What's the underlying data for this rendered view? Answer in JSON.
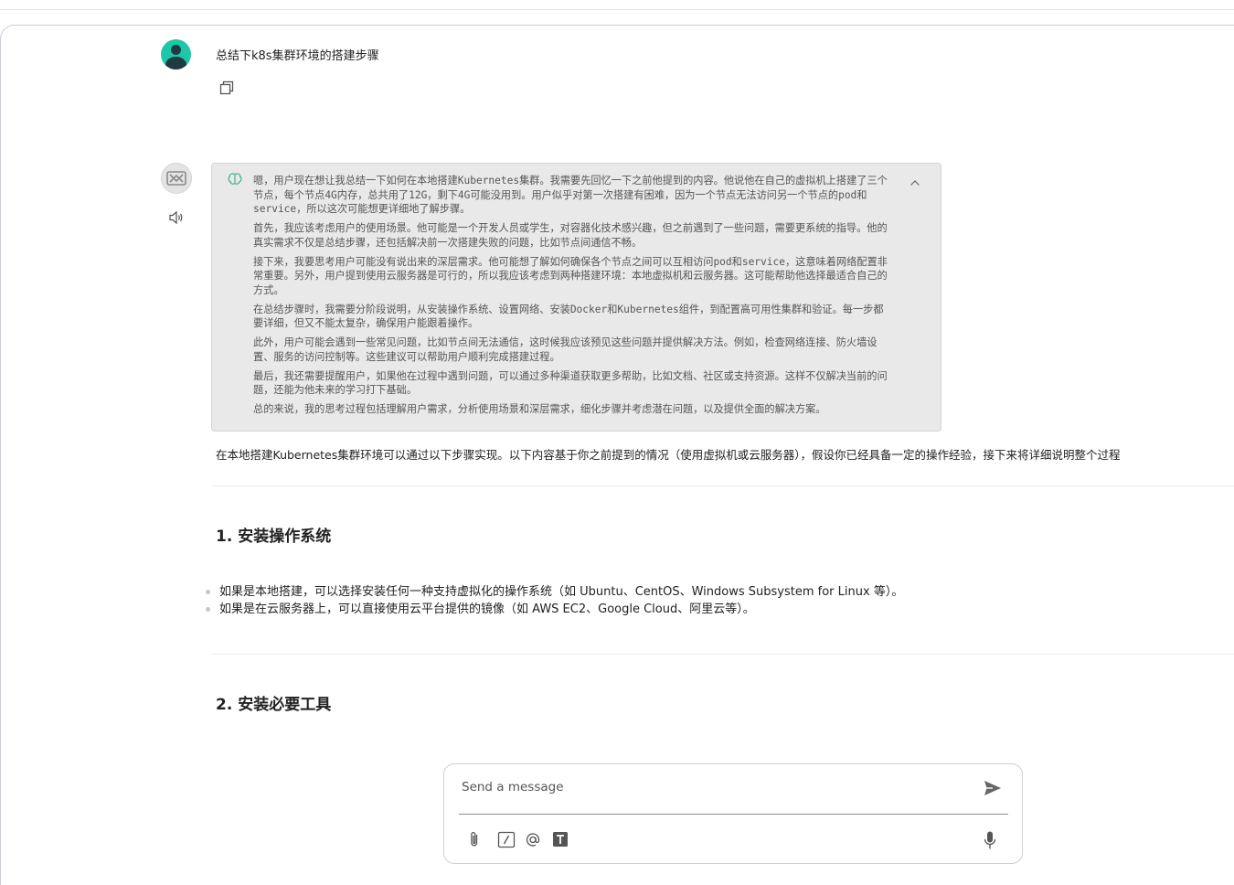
{
  "user_message": {
    "text": "总结下k8s集群环境的搭建步骤",
    "icons": [
      "user-avatar",
      "copy-icon"
    ]
  },
  "assistant": {
    "icons": [
      "bot-avatar",
      "speaker-icon",
      "brain-icon",
      "chevron-up-icon"
    ],
    "thinking": [
      "嗯，用户现在想让我总结一下如何在本地搭建Kubernetes集群。我需要先回忆一下之前他提到的内容。他说他在自己的虚拟机上搭建了三个节点，每个节点4G内存，总共用了12G，剩下4G可能没用到。用户似乎对第一次搭建有困难，因为一个节点无法访问另一个节点的pod和service，所以这次可能想更详细地了解步骤。",
      "首先，我应该考虑用户的使用场景。他可能是一个开发人员或学生，对容器化技术感兴趣，但之前遇到了一些问题，需要更系统的指导。他的真实需求不仅是总结步骤，还包括解决前一次搭建失败的问题，比如节点间通信不畅。",
      "接下来，我要思考用户可能没有说出来的深层需求。他可能想了解如何确保各个节点之间可以互相访问pod和service，这意味着网络配置非常重要。另外，用户提到使用云服务器是可行的，所以我应该考虑到两种搭建环境：本地虚拟机和云服务器。这可能帮助他选择最适合自己的方式。",
      "在总结步骤时，我需要分阶段说明，从安装操作系统、设置网络、安装Docker和Kubernetes组件，到配置高可用性集群和验证。每一步都要详细，但又不能太复杂，确保用户能跟着操作。",
      "此外，用户可能会遇到一些常见问题，比如节点间无法通信，这时候我应该预见这些问题并提供解决方法。例如，检查网络连接、防火墙设置、服务的访问控制等。这些建议可以帮助用户顺利完成搭建过程。",
      "最后，我还需要提醒用户，如果他在过程中遇到问题，可以通过多种渠道获取更多帮助，比如文档、社区或支持资源。这样不仅解决当前的问题，还能为他未来的学习打下基础。",
      "总的来说，我的思考过程包括理解用户需求，分析使用场景和深层需求，细化步骤并考虑潜在问题，以及提供全面的解决方案。"
    ],
    "intro": "在本地搭建Kubernetes集群环境可以通过以下步骤实现。以下内容基于你之前提到的情况（使用虚拟机或云服务器），假设你已经具备一定的操作经验，接下来将详细说明整个过程",
    "sections": [
      {
        "heading": "1. 安装操作系统",
        "bullets": [
          "如果是本地搭建，可以选择安装任何一种支持虚拟化的操作系统（如 Ubuntu、CentOS、Windows Subsystem for Linux 等）。",
          "如果是在云服务器上，可以直接使用云平台提供的镜像（如 AWS EC2、Google Cloud、阿里云等）。"
        ]
      },
      {
        "heading": "2. 安装必要工具"
      }
    ]
  },
  "composer": {
    "placeholder": "Send a message",
    "icons": [
      "send-icon",
      "paperclip-icon",
      "slash-command-icon",
      "mention-icon",
      "text-format-icon",
      "microphone-icon"
    ]
  }
}
